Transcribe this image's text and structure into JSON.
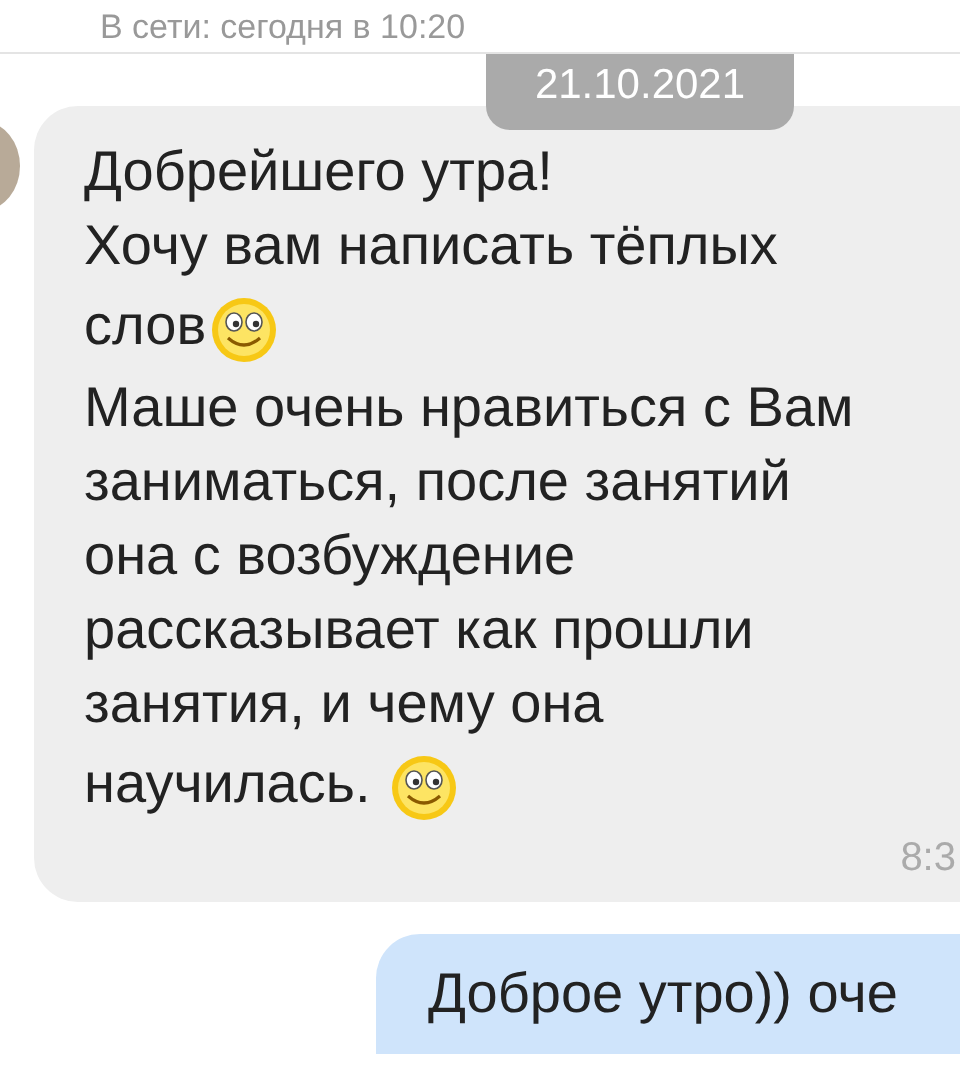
{
  "header": {
    "status": "В сети: сегодня в 10:20"
  },
  "date": "21.10.2021",
  "incoming": {
    "lines": [
      {
        "text": "Добрейшего утра!",
        "emoji": false
      },
      {
        "text": "Хочу вам написать тёплых",
        "emoji": false
      },
      {
        "text": "слов",
        "emoji": true
      },
      {
        "text": "Маше очень нравиться с Вам",
        "emoji": false
      },
      {
        "text": "заниматься, после занятий",
        "emoji": false
      },
      {
        "text": "она с возбуждение",
        "emoji": false
      },
      {
        "text": "рассказывает как прошли",
        "emoji": false
      },
      {
        "text": "занятия, и чему она",
        "emoji": false
      },
      {
        "text": "научилась. ",
        "emoji": true
      }
    ],
    "time": "8:3"
  },
  "outgoing": {
    "text": "Доброе утро)) оче"
  }
}
